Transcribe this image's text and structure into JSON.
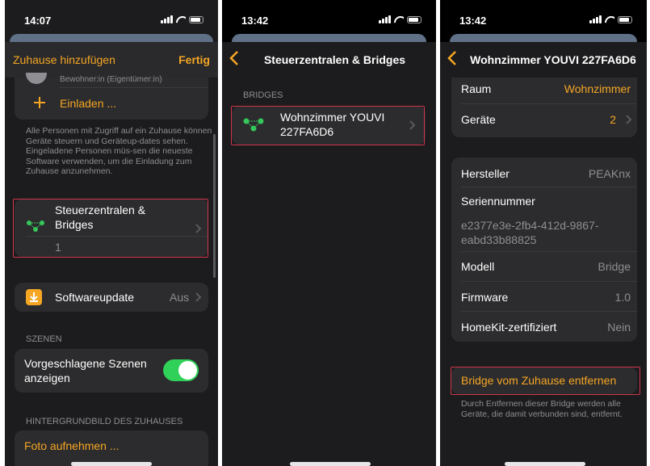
{
  "screen1": {
    "time": "14:07",
    "nav_left": "Zuhause hinzufügen",
    "nav_right": "Fertig",
    "resident_role": "Bewohner:in (Eigentümer:in)",
    "invite_label": "Einladen ...",
    "info_text": "Alle Personen mit Zugriff auf ein Zuhause können Geräte steuern und Geräteup-dates sehen. Eingeladene Personen müs-sen die neueste Software verwenden, um die Einladung zum Zuhause anzunehmen.",
    "bridges_label_line1": "Steuerzentralen &",
    "bridges_label_line2": "Bridges",
    "bridges_count": "1",
    "software_update_label": "Softwareupdate",
    "software_update_value": "Aus",
    "scenes_header": "SZENEN",
    "suggested_scenes_line1": "Vorgeschlagene Szenen",
    "suggested_scenes_line2": "anzeigen",
    "wallpaper_header": "HINTERGRUNDBILD DES ZUHAUSES",
    "take_photo": "Foto aufnehmen ..."
  },
  "screen2": {
    "time": "13:42",
    "title": "Steuerzentralen & Bridges",
    "section_header": "BRIDGES",
    "bridge_name_line1": "Wohnzimmer YOUVI",
    "bridge_name_line2": "227FA6D6"
  },
  "screen3": {
    "time": "13:42",
    "title": "Wohnzimmer YOUVI 227FA6D6",
    "room_label": "Raum",
    "room_value": "Wohnzimmer",
    "devices_label": "Geräte",
    "devices_value": "2",
    "manufacturer_label": "Hersteller",
    "manufacturer_value": "PEAKnx",
    "serial_label": "Seriennummer",
    "serial_value_line1": "e2377e3e-2fb4-412d-9867-",
    "serial_value_line2": "eabd33b88825",
    "model_label": "Modell",
    "model_value": "Bridge",
    "firmware_label": "Firmware",
    "firmware_value": "1.0",
    "homekit_label": "HomeKit-zertifiziert",
    "homekit_value": "Nein",
    "remove_button": "Bridge vom Zuhause entfernen",
    "remove_info": "Durch Entfernen dieser Bridge werden alle Geräte, die damit verbunden sind, entfernt."
  },
  "colors": {
    "accent": "#f5a623",
    "toggle_on": "#30d158",
    "highlight": "#d0354a",
    "bridge_icon": "#34c759"
  },
  "icons": [
    "signal-icon",
    "wifi-icon",
    "battery-icon",
    "back-chevron-icon",
    "chevron-right-icon",
    "plus-icon",
    "bridge-icon",
    "software-update-icon"
  ]
}
